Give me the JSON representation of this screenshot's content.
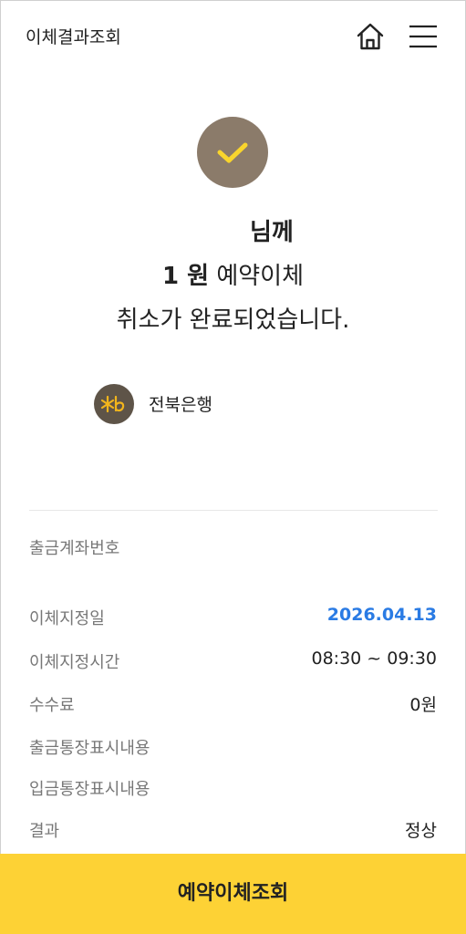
{
  "header": {
    "title": "이체결과조회"
  },
  "result": {
    "name_suffix": "님께",
    "amount_number": "1 원",
    "amount_suffix": "예약이체",
    "message": "취소가 완료되었습니다.",
    "bank_name": "전북은행"
  },
  "details": {
    "rows": [
      {
        "label": "출금계좌번호",
        "value": ""
      },
      {
        "label": "이체지정일",
        "value": "2026.04.13"
      },
      {
        "label": "이체지정시간",
        "value": "08:30 ~ 09:30"
      },
      {
        "label": "수수료",
        "value": "0원"
      },
      {
        "label": "출금통장표시내용",
        "value": ""
      },
      {
        "label": "입금통장표시내용",
        "value": ""
      },
      {
        "label": "결과",
        "value": "정상"
      }
    ]
  },
  "button": {
    "label": "예약이체조회"
  },
  "icons": {
    "home": "home-icon",
    "menu": "hamburger-menu-icon",
    "check": "check-circle-icon",
    "bank_logo": "jb-bank-logo-icon"
  },
  "colors": {
    "accent_yellow": "#fdd235",
    "check_circle": "#8b7b6a",
    "date_blue": "#2a7be4",
    "bank_logo_bg": "#5e5448"
  }
}
